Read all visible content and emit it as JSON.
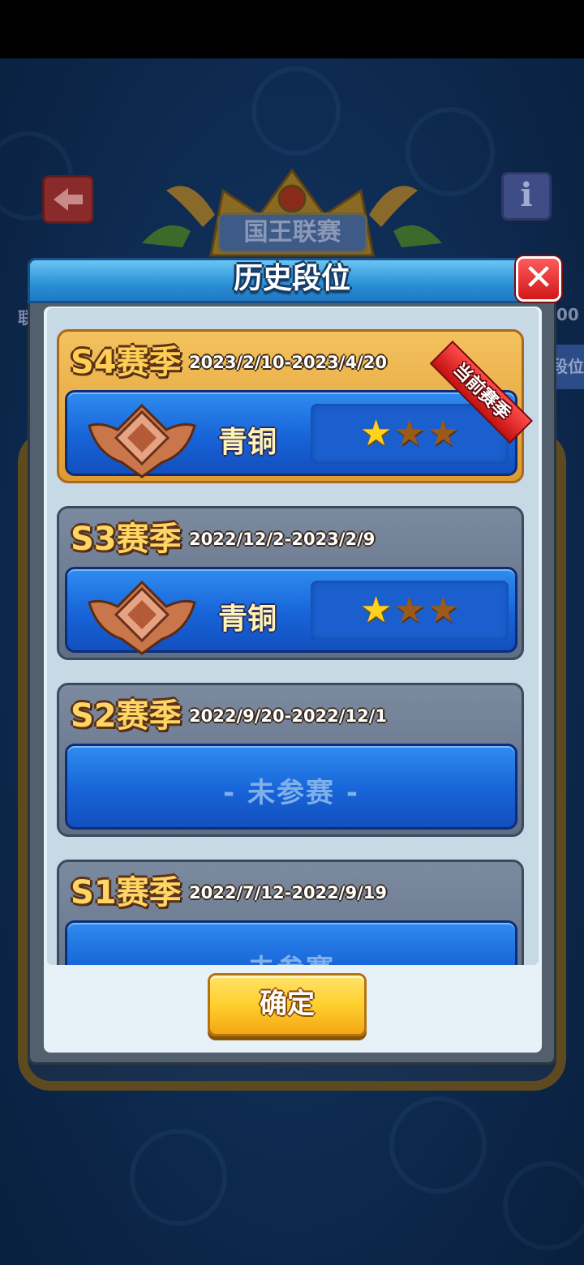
{
  "background_header": {
    "title": "国王联赛",
    "left_edge_text": "联",
    "right_edge_text": "00",
    "right_tab_text": "段位"
  },
  "dialog": {
    "title": "历史段位",
    "confirm_label": "确定",
    "current_ribbon": "当前赛季"
  },
  "seasons": [
    {
      "name": "S4赛季",
      "dates": "2023/2/10-2023/4/20",
      "rank": "青铜",
      "stars_filled": 1,
      "stars_total": 3,
      "participated": true,
      "current": true
    },
    {
      "name": "S3赛季",
      "dates": "2022/12/2-2023/2/9",
      "rank": "青铜",
      "stars_filled": 1,
      "stars_total": 3,
      "participated": true,
      "current": false
    },
    {
      "name": "S2赛季",
      "dates": "2022/9/20-2022/12/1",
      "status": "- 未参赛 -",
      "participated": false,
      "current": false
    },
    {
      "name": "S1赛季",
      "dates": "2022/7/12-2022/9/19",
      "status": "- 未参赛 -",
      "participated": false,
      "current": false
    }
  ],
  "icons": {
    "back": "back-arrow-icon",
    "info": "info-icon",
    "close": "close-icon",
    "badge": "bronze-badge-icon",
    "star": "star-icon"
  },
  "colors": {
    "current_card": "#de9a32",
    "normal_card": "#6a7890",
    "rank_panel": "#1764d8",
    "confirm_button": "#ffcf2e",
    "close_button": "#d11818"
  }
}
